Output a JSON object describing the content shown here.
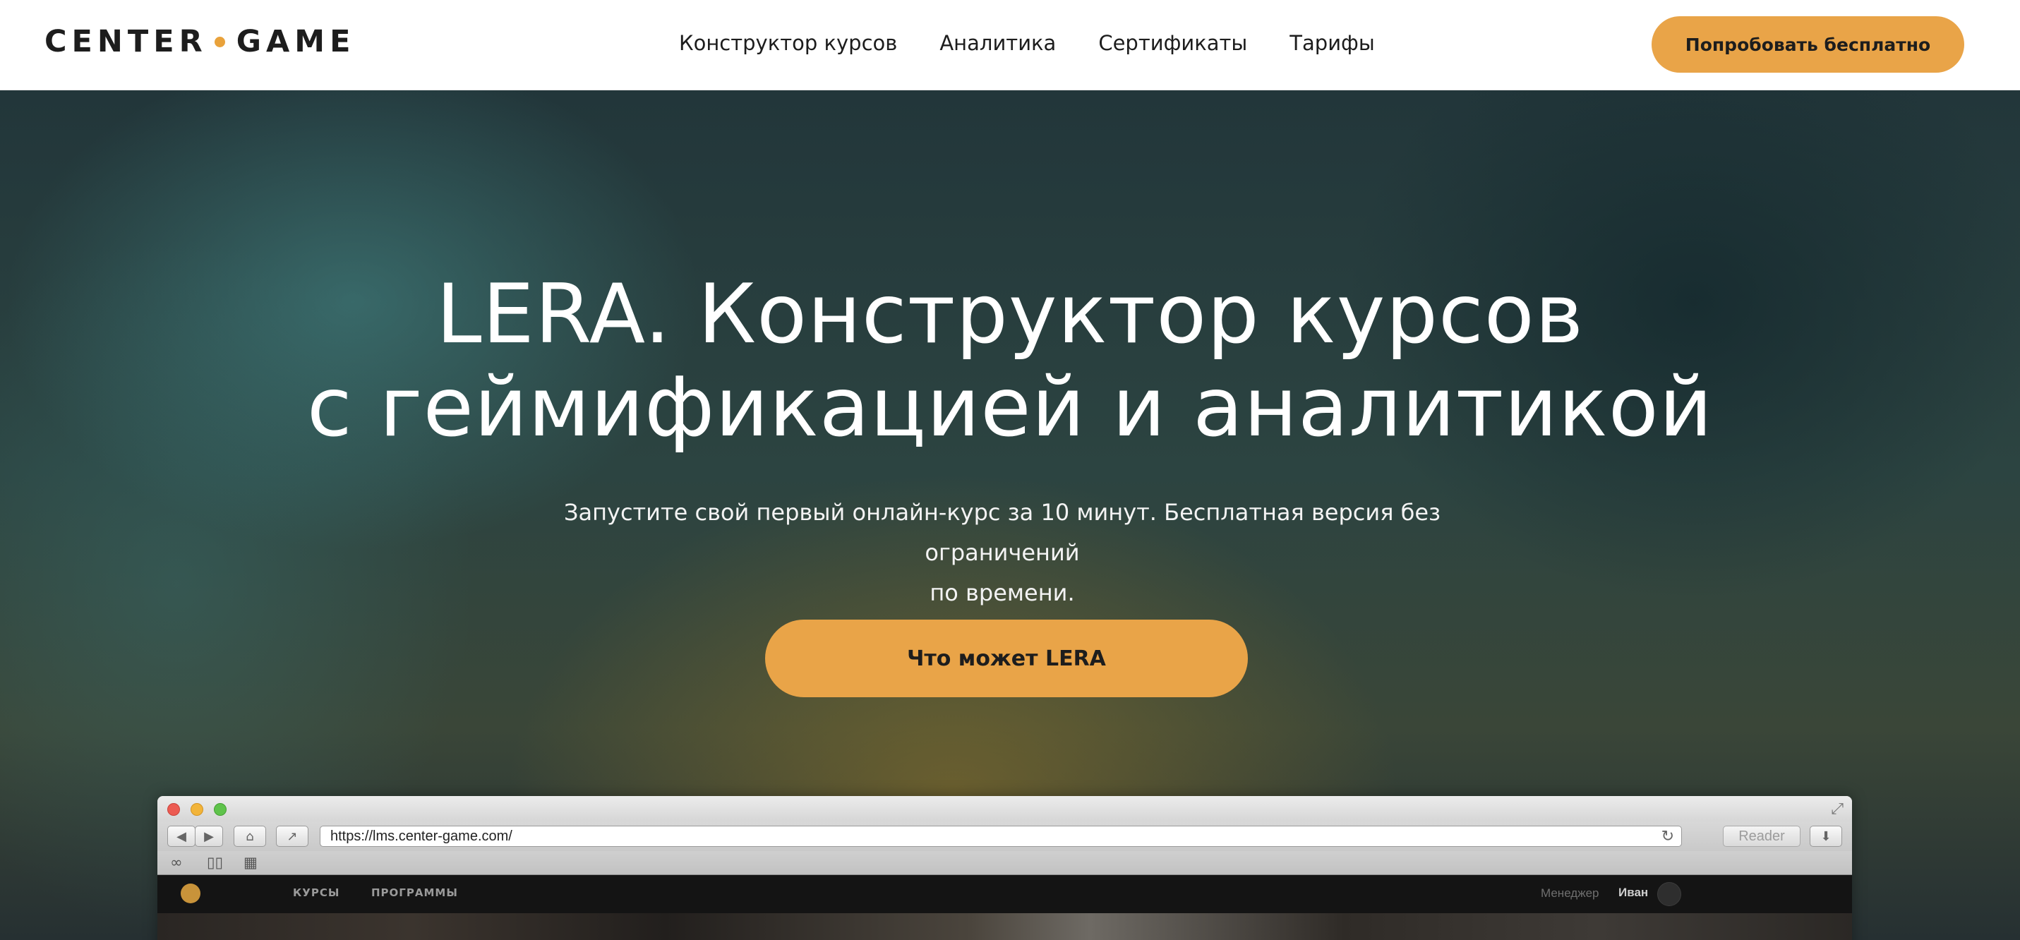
{
  "header": {
    "logo": {
      "left": "CENTER",
      "right": "GAME"
    },
    "nav": [
      {
        "label": "Конструктор курсов"
      },
      {
        "label": "Аналитика"
      },
      {
        "label": "Сертификаты"
      },
      {
        "label": "Тарифы"
      }
    ],
    "cta_label": "Попробовать бесплатно"
  },
  "hero": {
    "title_line1": "LERA. Конструктор курсов",
    "title_line2": "с геймификацией и аналитикой",
    "subtitle_line1": "Запустите свой первый онлайн-курс за 10 минут. Бесплатная версия без ограничений",
    "subtitle_line2": "по времени.",
    "cta_label": "Что может LERA"
  },
  "browser": {
    "url": "https://lms.center-game.com/",
    "reader_label": "Reader",
    "lms": {
      "nav": [
        "КУРСЫ",
        "ПРОГРАММЫ"
      ],
      "role": "Менеджер",
      "user": "Иван"
    }
  },
  "colors": {
    "accent": "#e9a448",
    "logo_dot": "#e9a23b",
    "text_dark": "#1d1d1d"
  },
  "icons": [
    "back-icon",
    "forward-icon",
    "home-icon",
    "share-icon",
    "reload-icon",
    "download-icon",
    "reading-list-icon",
    "bookmarks-icon",
    "top-sites-icon",
    "expand-icon",
    "user-avatar-icon"
  ]
}
